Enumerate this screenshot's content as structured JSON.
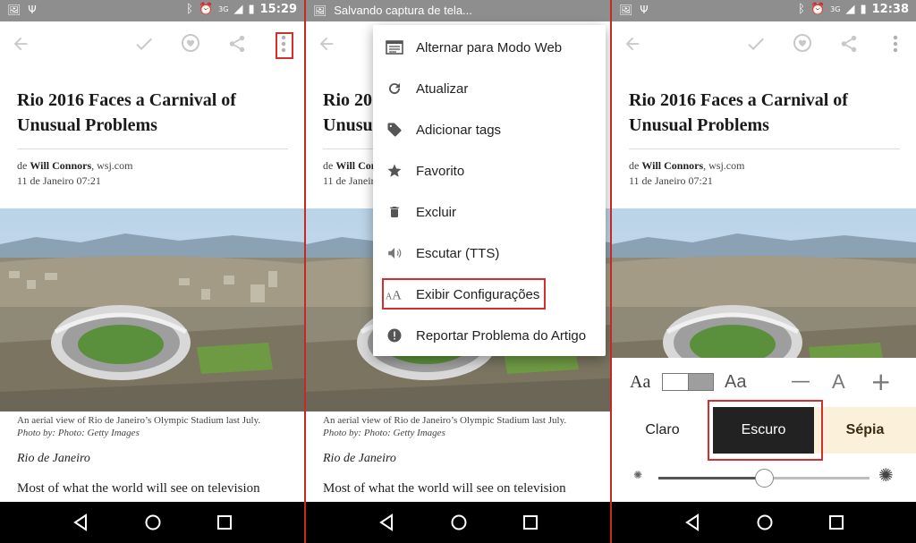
{
  "status_bars": {
    "p1_time": "15:29",
    "p2_text": "Salvando captura de tela...",
    "p3_time": "12:38",
    "network_label": "3G"
  },
  "article": {
    "title": "Rio 2016 Faces a Carnival of Unusual Problems",
    "byline_prefix": "de",
    "author": "Will Connors",
    "source": ", wsj.com",
    "date": "11 de Janeiro 07:21",
    "caption": "An aerial view of Rio de Janeiro’s Olympic Stadium last July.",
    "photo_credit": "Photo by: Photo: Getty Images",
    "dateline": "Rio de Janeiro",
    "body_start": "Most of what the world will see on television"
  },
  "menu": {
    "items": [
      {
        "label": "Alternar para Modo Web",
        "icon": "web-mode-icon"
      },
      {
        "label": "Atualizar",
        "icon": "refresh-icon"
      },
      {
        "label": "Adicionar tags",
        "icon": "tag-icon"
      },
      {
        "label": "Favorito",
        "icon": "star-icon"
      },
      {
        "label": "Excluir",
        "icon": "trash-icon"
      },
      {
        "label": "Escutar (TTS)",
        "icon": "speaker-icon"
      },
      {
        "label": "Exibir Configurações",
        "icon": "font-settings-icon"
      },
      {
        "label": "Reportar Problema do Artigo",
        "icon": "alert-icon"
      }
    ]
  },
  "settings": {
    "font_serif_label": "Aa",
    "font_sans_label": "Aa",
    "size_label": "A",
    "minus": "—",
    "plus": "+",
    "themes": [
      "Claro",
      "Escuro",
      "Sépia"
    ],
    "brightness": 0.5
  },
  "colors": {
    "highlight": "#d32f2f",
    "dark_theme": "#222222",
    "sepia_theme": "#fbf0d9"
  }
}
